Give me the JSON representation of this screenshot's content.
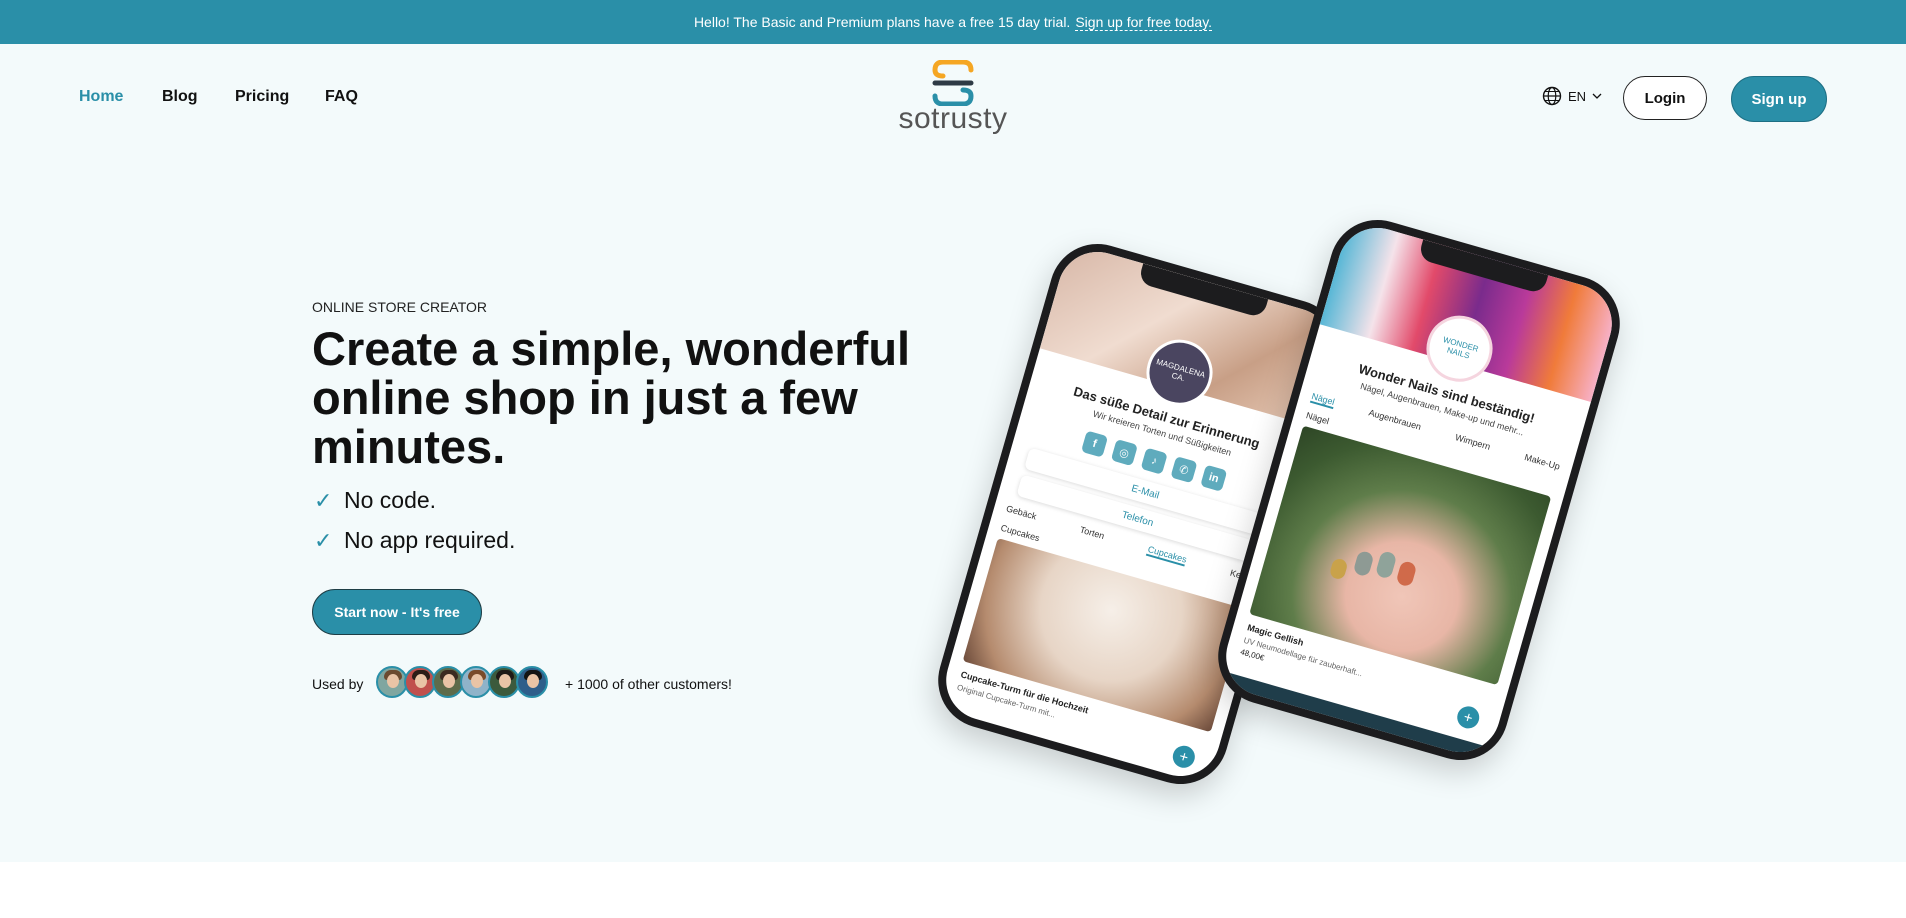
{
  "banner": {
    "text": "Hello! The Basic and Premium plans have a free 15 day trial.",
    "link": "Sign up for free today."
  },
  "nav": {
    "links": [
      "Home",
      "Blog",
      "Pricing",
      "FAQ"
    ],
    "active": "Home"
  },
  "logo": {
    "text": "sotrusty"
  },
  "header": {
    "language": "EN",
    "login": "Login",
    "signup": "Sign up"
  },
  "hero": {
    "eyebrow": "ONLINE STORE CREATOR",
    "headline": "Create a simple, wonderful online shop in just a few minutes.",
    "features": [
      "No code.",
      "No app required."
    ],
    "cta": "Start now - It's free",
    "used_by": "Used by",
    "customers": "+ 1000 of other customers!"
  },
  "phone_left": {
    "badge": "MAGDALENA CA.",
    "title": "Das süße Detail zur Erinnerung",
    "subtitle": "Wir kreieren Torten und Süßigkeiten",
    "email": "E-Mail",
    "phone": "Telefon",
    "tabs": [
      "Gebäck",
      "Torten",
      "Cupcakes",
      "Kekse"
    ],
    "active_tab": "Cupcakes",
    "section": "Cupcakes",
    "product": "Cupcake-Turm für die Hochzeit",
    "product_desc": "Original Cupcake-Turm mit..."
  },
  "phone_right": {
    "badge": "WONDER NAILS",
    "title": "Wonder Nails sind beständig!",
    "subtitle": "Nägel, Augenbrauen, Make-up und mehr...",
    "tabs": [
      "Nägel",
      "Augenbrauen",
      "Wimpern",
      "Make-Up"
    ],
    "active_tab": "Nägel",
    "section": "Nägel",
    "product": "Magic Gellish",
    "product_desc": "UV Neumodellage für zauberhaft...",
    "price": "48,00€"
  },
  "colors": {
    "accent": "#2a8fa8",
    "hero_bg": "#f3fafb",
    "logo_orange": "#f5a623"
  }
}
